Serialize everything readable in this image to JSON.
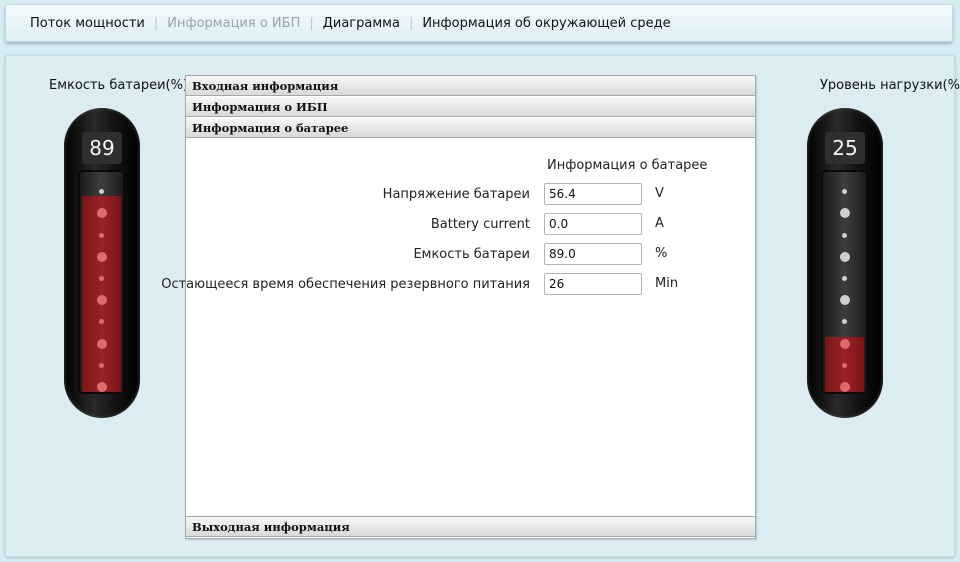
{
  "tabs": [
    {
      "label": "Поток мощности",
      "disabled": false
    },
    {
      "label": "Информация о ИБП",
      "disabled": true
    },
    {
      "label": "Диаграмма",
      "disabled": false
    },
    {
      "label": "Информация об окружающей среде",
      "disabled": false
    }
  ],
  "left_gauge": {
    "label": "Емкость батареи(%)",
    "value": "89",
    "fill_fraction": 0.89
  },
  "right_gauge": {
    "label": "Уровень нагрузки(%)",
    "value": "25",
    "fill_fraction": 0.25
  },
  "accordion": {
    "input_info": "Входная информация",
    "ups_info": "Информация о ИБП",
    "battery_info": "Информация о батарее",
    "output_info": "Выходная информация"
  },
  "battery": {
    "title": "Информация о батарее",
    "rows": [
      {
        "label": "Напряжение батареи",
        "value": "56.4",
        "unit": "V"
      },
      {
        "label": "Battery current",
        "value": "0.0",
        "unit": "A"
      },
      {
        "label": "Емкость батареи",
        "value": "89.0",
        "unit": "%"
      },
      {
        "label": "Остающееся время обеспечения резервного питания",
        "value": "26",
        "unit": "Min"
      }
    ]
  },
  "colors": {
    "background": "#d6ecf3",
    "gauge_fill": "#9c2125"
  }
}
